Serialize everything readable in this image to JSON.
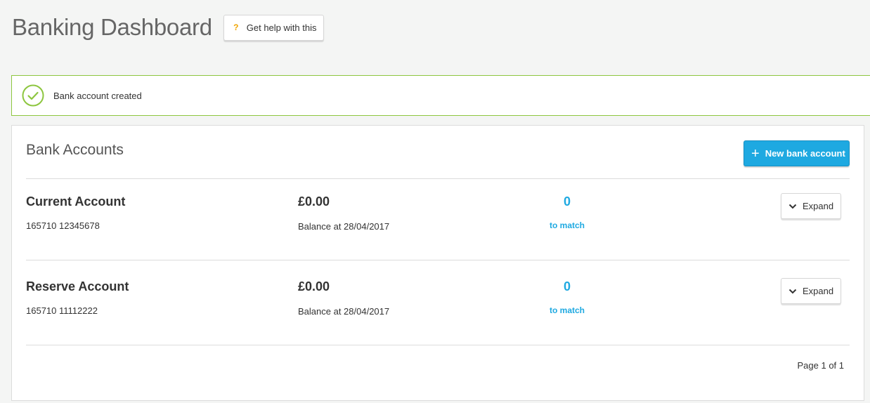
{
  "header": {
    "title": "Banking Dashboard",
    "help_label": "Get help with this",
    "help_icon": "question-mark-icon"
  },
  "alert": {
    "message": "Bank account created",
    "icon": "check-circle-icon",
    "color": "#8dc63f"
  },
  "panel": {
    "title": "Bank Accounts",
    "new_button_label": "New bank account",
    "new_button_color": "#1ea9e1"
  },
  "accounts": [
    {
      "name": "Current Account",
      "number": "165710  12345678",
      "balance": "£0.00",
      "balance_date": "Balance at 28/04/2017",
      "match_count": "0",
      "match_label": "to match",
      "expand_label": "Expand"
    },
    {
      "name": "Reserve Account",
      "number": "165710  11112222",
      "balance": "£0.00",
      "balance_date": "Balance at 28/04/2017",
      "match_count": "0",
      "match_label": "to match",
      "expand_label": "Expand"
    }
  ],
  "pagination": {
    "text": "Page 1 of 1"
  }
}
